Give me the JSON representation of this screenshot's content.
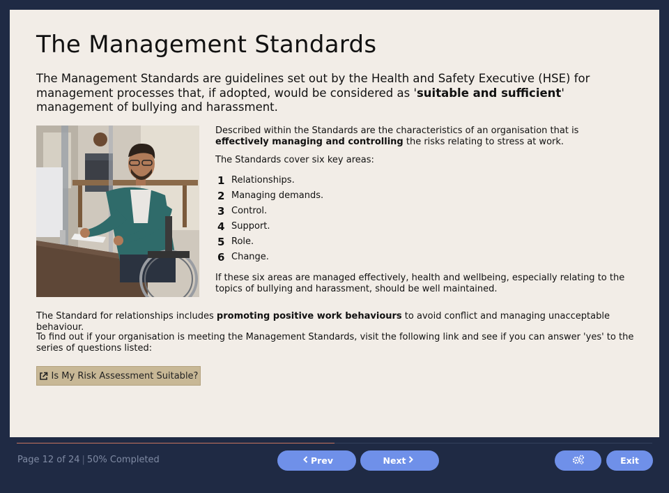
{
  "page": {
    "title": "The Management Standards",
    "intro": {
      "before": "The Management Standards are guidelines set out by the Health and Safety Executive (HSE) for management processes that, if adopted, would be considered as '",
      "bold": "suitable and sufficient",
      "after": "' management of bullying and harassment."
    },
    "description": {
      "before": "Described within the Standards are the characteristics of an organisation that is ",
      "bold": "effectively managing and controlling",
      "after": " the risks relating to stress at work."
    },
    "areas_intro": "The Standards cover six key areas:",
    "areas": [
      {
        "num": "1",
        "label": "Relationships."
      },
      {
        "num": "2",
        "label": "Managing demands."
      },
      {
        "num": "3",
        "label": "Control."
      },
      {
        "num": "4",
        "label": "Support."
      },
      {
        "num": "5",
        "label": "Role."
      },
      {
        "num": "6",
        "label": "Change."
      }
    ],
    "areas_outro": "If these six areas are managed effectively, health and wellbeing, especially relating to the topics of bullying and harassment, should be well maintained.",
    "relationships": {
      "before": "The Standard for relationships includes ",
      "bold": "promoting positive work behaviours",
      "after": " to avoid conflict and managing unacceptable behaviour."
    },
    "find_out": "To find out if your organisation is meeting the Management Standards, visit the following link and see if you can answer 'yes' to the series of questions listed:",
    "link_button": "Is My Risk Assessment Suitable?",
    "link_icon": "external-link-icon",
    "photo_icon": "person-at-desk-photo"
  },
  "footer": {
    "page_label": "Page 12 of 24",
    "separator": "|",
    "completed": "50% Completed",
    "progress_fraction": 0.5,
    "prev_label": "Prev",
    "next_label": "Next",
    "exit_label": "Exit",
    "settings_icon": "gears-icon",
    "prev_icon": "chevron-left-icon",
    "next_icon": "chevron-right-icon"
  },
  "colors": {
    "background": "#1f2a44",
    "panel": "#f2ede7",
    "button": "#6f90e9",
    "link_button": "#c8b896",
    "progress": "#c7745e"
  }
}
